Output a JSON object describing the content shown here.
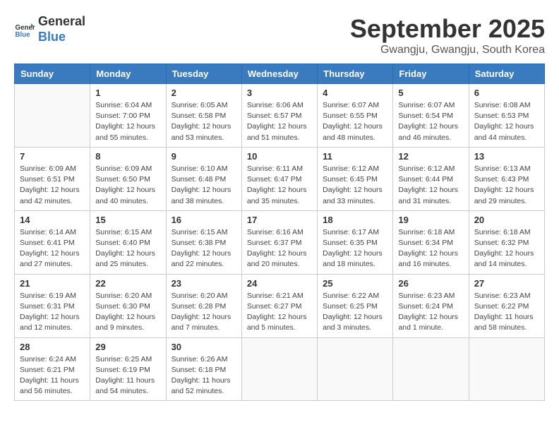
{
  "header": {
    "logo_line1": "General",
    "logo_line2": "Blue",
    "month": "September 2025",
    "location": "Gwangju, Gwangju, South Korea"
  },
  "days_of_week": [
    "Sunday",
    "Monday",
    "Tuesday",
    "Wednesday",
    "Thursday",
    "Friday",
    "Saturday"
  ],
  "weeks": [
    [
      {
        "day": "",
        "info": ""
      },
      {
        "day": "1",
        "info": "Sunrise: 6:04 AM\nSunset: 7:00 PM\nDaylight: 12 hours\nand 55 minutes."
      },
      {
        "day": "2",
        "info": "Sunrise: 6:05 AM\nSunset: 6:58 PM\nDaylight: 12 hours\nand 53 minutes."
      },
      {
        "day": "3",
        "info": "Sunrise: 6:06 AM\nSunset: 6:57 PM\nDaylight: 12 hours\nand 51 minutes."
      },
      {
        "day": "4",
        "info": "Sunrise: 6:07 AM\nSunset: 6:55 PM\nDaylight: 12 hours\nand 48 minutes."
      },
      {
        "day": "5",
        "info": "Sunrise: 6:07 AM\nSunset: 6:54 PM\nDaylight: 12 hours\nand 46 minutes."
      },
      {
        "day": "6",
        "info": "Sunrise: 6:08 AM\nSunset: 6:53 PM\nDaylight: 12 hours\nand 44 minutes."
      }
    ],
    [
      {
        "day": "7",
        "info": "Sunrise: 6:09 AM\nSunset: 6:51 PM\nDaylight: 12 hours\nand 42 minutes."
      },
      {
        "day": "8",
        "info": "Sunrise: 6:09 AM\nSunset: 6:50 PM\nDaylight: 12 hours\nand 40 minutes."
      },
      {
        "day": "9",
        "info": "Sunrise: 6:10 AM\nSunset: 6:48 PM\nDaylight: 12 hours\nand 38 minutes."
      },
      {
        "day": "10",
        "info": "Sunrise: 6:11 AM\nSunset: 6:47 PM\nDaylight: 12 hours\nand 35 minutes."
      },
      {
        "day": "11",
        "info": "Sunrise: 6:12 AM\nSunset: 6:45 PM\nDaylight: 12 hours\nand 33 minutes."
      },
      {
        "day": "12",
        "info": "Sunrise: 6:12 AM\nSunset: 6:44 PM\nDaylight: 12 hours\nand 31 minutes."
      },
      {
        "day": "13",
        "info": "Sunrise: 6:13 AM\nSunset: 6:43 PM\nDaylight: 12 hours\nand 29 minutes."
      }
    ],
    [
      {
        "day": "14",
        "info": "Sunrise: 6:14 AM\nSunset: 6:41 PM\nDaylight: 12 hours\nand 27 minutes."
      },
      {
        "day": "15",
        "info": "Sunrise: 6:15 AM\nSunset: 6:40 PM\nDaylight: 12 hours\nand 25 minutes."
      },
      {
        "day": "16",
        "info": "Sunrise: 6:15 AM\nSunset: 6:38 PM\nDaylight: 12 hours\nand 22 minutes."
      },
      {
        "day": "17",
        "info": "Sunrise: 6:16 AM\nSunset: 6:37 PM\nDaylight: 12 hours\nand 20 minutes."
      },
      {
        "day": "18",
        "info": "Sunrise: 6:17 AM\nSunset: 6:35 PM\nDaylight: 12 hours\nand 18 minutes."
      },
      {
        "day": "19",
        "info": "Sunrise: 6:18 AM\nSunset: 6:34 PM\nDaylight: 12 hours\nand 16 minutes."
      },
      {
        "day": "20",
        "info": "Sunrise: 6:18 AM\nSunset: 6:32 PM\nDaylight: 12 hours\nand 14 minutes."
      }
    ],
    [
      {
        "day": "21",
        "info": "Sunrise: 6:19 AM\nSunset: 6:31 PM\nDaylight: 12 hours\nand 12 minutes."
      },
      {
        "day": "22",
        "info": "Sunrise: 6:20 AM\nSunset: 6:30 PM\nDaylight: 12 hours\nand 9 minutes."
      },
      {
        "day": "23",
        "info": "Sunrise: 6:20 AM\nSunset: 6:28 PM\nDaylight: 12 hours\nand 7 minutes."
      },
      {
        "day": "24",
        "info": "Sunrise: 6:21 AM\nSunset: 6:27 PM\nDaylight: 12 hours\nand 5 minutes."
      },
      {
        "day": "25",
        "info": "Sunrise: 6:22 AM\nSunset: 6:25 PM\nDaylight: 12 hours\nand 3 minutes."
      },
      {
        "day": "26",
        "info": "Sunrise: 6:23 AM\nSunset: 6:24 PM\nDaylight: 12 hours\nand 1 minute."
      },
      {
        "day": "27",
        "info": "Sunrise: 6:23 AM\nSunset: 6:22 PM\nDaylight: 11 hours\nand 58 minutes."
      }
    ],
    [
      {
        "day": "28",
        "info": "Sunrise: 6:24 AM\nSunset: 6:21 PM\nDaylight: 11 hours\nand 56 minutes."
      },
      {
        "day": "29",
        "info": "Sunrise: 6:25 AM\nSunset: 6:19 PM\nDaylight: 11 hours\nand 54 minutes."
      },
      {
        "day": "30",
        "info": "Sunrise: 6:26 AM\nSunset: 6:18 PM\nDaylight: 11 hours\nand 52 minutes."
      },
      {
        "day": "",
        "info": ""
      },
      {
        "day": "",
        "info": ""
      },
      {
        "day": "",
        "info": ""
      },
      {
        "day": "",
        "info": ""
      }
    ]
  ]
}
